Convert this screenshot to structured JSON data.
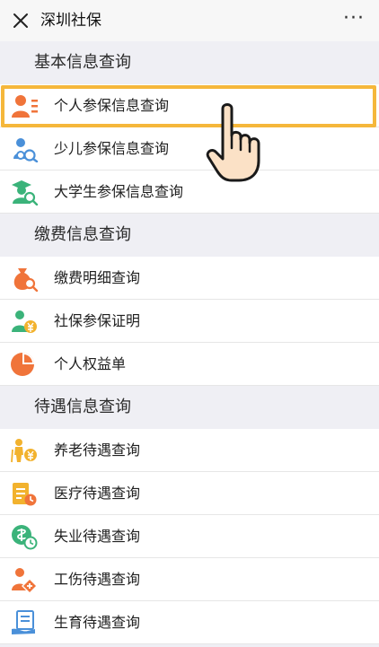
{
  "header": {
    "title": "深圳社保",
    "more": "···"
  },
  "sections": [
    {
      "title": "基本信息查询",
      "items": [
        {
          "label": "个人参保信息查询",
          "icon": "person-id-icon"
        },
        {
          "label": "少儿参保信息查询",
          "icon": "child-search-icon"
        },
        {
          "label": "大学生参保信息查询",
          "icon": "graduate-search-icon"
        }
      ]
    },
    {
      "title": "缴费信息查询",
      "items": [
        {
          "label": "缴费明细查询",
          "icon": "money-bag-search-icon"
        },
        {
          "label": "社保参保证明",
          "icon": "person-yuan-icon"
        },
        {
          "label": "个人权益单",
          "icon": "pie-chart-icon"
        }
      ]
    },
    {
      "title": "待遇信息查询",
      "items": [
        {
          "label": "养老待遇查询",
          "icon": "elderly-yuan-icon"
        },
        {
          "label": "医疗待遇查询",
          "icon": "medical-record-icon"
        },
        {
          "label": "失业待遇查询",
          "icon": "coin-clock-icon"
        },
        {
          "label": "工伤待遇查询",
          "icon": "injury-icon"
        },
        {
          "label": "生育待遇查询",
          "icon": "document-hand-icon"
        }
      ]
    }
  ],
  "colors": {
    "highlight": "#f5b73b",
    "orange": "#f0743a",
    "blue": "#4a90d9",
    "green": "#3bb37a",
    "yellow": "#f2b22e"
  }
}
